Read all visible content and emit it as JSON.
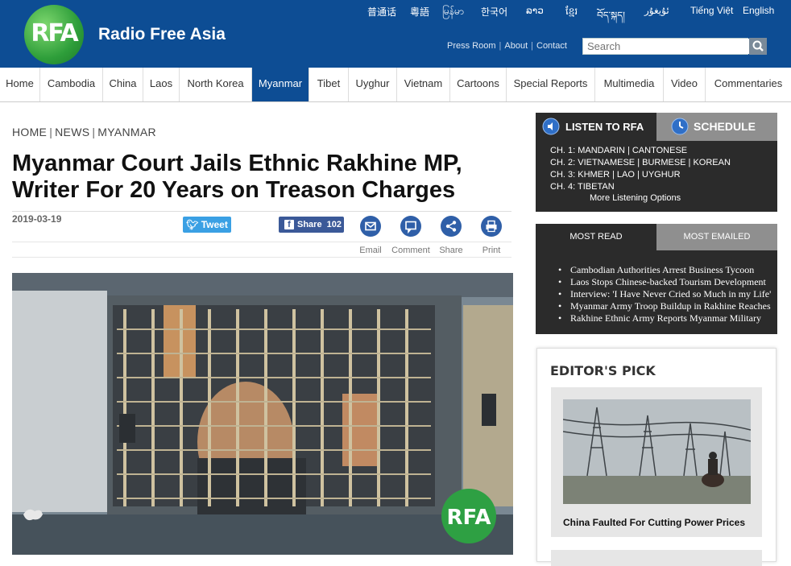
{
  "header": {
    "logo_text": "RFA",
    "site_name": "Radio Free Asia",
    "languages": [
      "普通话",
      "粵語",
      "မြန်မာ",
      "한국어",
      "ລາວ",
      "ខ្មែរ",
      "བོད་སྐད།",
      "ئۇيغۇر",
      "Tiếng Việt",
      "English"
    ],
    "links": [
      "Press Room",
      "About",
      "Contact"
    ],
    "search_placeholder": "Search"
  },
  "nav": {
    "items": [
      "Home",
      "Cambodia",
      "China",
      "Laos",
      "North Korea",
      "Myanmar",
      "Tibet",
      "Uyghur",
      "Vietnam",
      "Cartoons",
      "Special Reports",
      "Multimedia",
      "Video",
      "Commentaries"
    ],
    "active": "Myanmar"
  },
  "article": {
    "breadcrumb": [
      "HOME",
      "NEWS",
      "MYANMAR"
    ],
    "headline_line1": "Myanmar Court Jails Ethnic Rakhine MP,",
    "headline_line2": "Writer For 20 Years on Treason Charges",
    "date": "2019-03-19",
    "tweet_label": "Tweet",
    "share_label": "Share",
    "share_count": "102",
    "tools": [
      "Email",
      "Comment",
      "Share",
      "Print"
    ],
    "photo_watermark": "RFA"
  },
  "listen": {
    "tab_listen": "LISTEN TO RFA",
    "tab_schedule": "SCHEDULE",
    "channels": [
      "CH. 1: MANDARIN | CANTONESE",
      "CH. 2: VIETNAMESE | BURMESE | KOREAN",
      "CH. 3: KHMER | LAO | UYGHUR",
      "CH. 4: TIBETAN"
    ],
    "more": "More Listening Options"
  },
  "popular": {
    "tab_read": "MOST READ",
    "tab_emailed": "MOST EMAILED",
    "items": [
      "Cambodian Authorities Arrest Business Tycoon",
      "Laos Stops Chinese-backed Tourism Development",
      "Interview: 'I Have Never Cried so Much in my Life'",
      "Myanmar Army Troop Buildup in Rakhine Reaches",
      "Rakhine Ethnic Army Reports Myanmar Military"
    ]
  },
  "editor": {
    "title": "EDITOR'S PICK",
    "caption": "China Faulted For Cutting Power Prices"
  },
  "colors": {
    "brand_blue": "#0d4d94",
    "logo_green": "#2e9e3a",
    "dark_panel": "#2b2b2b"
  }
}
